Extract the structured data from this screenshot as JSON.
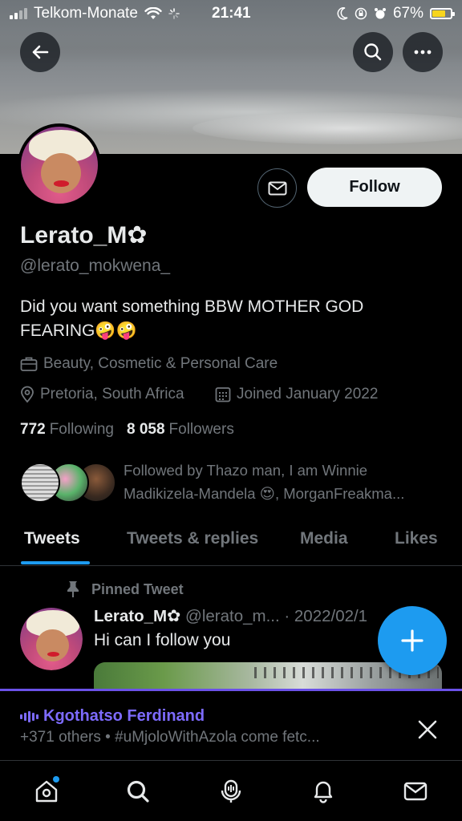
{
  "status_bar": {
    "carrier": "Telkom-Monate",
    "time": "21:41",
    "battery": "67%",
    "battery_level": 0.67
  },
  "profile": {
    "display_name": "Lerato_M✿",
    "handle": "@lerato_mokwena_",
    "bio": "Did you want something BBW MOTHER GOD FEARING🤪🤪",
    "category": "Beauty, Cosmetic & Personal Care",
    "location": "Pretoria, South Africa",
    "joined": "Joined January 2022",
    "following_count": "772",
    "following_label": "Following",
    "followers_count": "8 058",
    "followers_label": "Followers",
    "followed_by": "Followed by Thazo man, I am Winnie Madikizela-Mandela 😍, MorganFreakma..."
  },
  "actions": {
    "follow_label": "Follow"
  },
  "tabs": [
    {
      "label": "Tweets"
    },
    {
      "label": "Tweets & replies"
    },
    {
      "label": "Media"
    },
    {
      "label": "Likes"
    }
  ],
  "pinned_tweet": {
    "pinned_label": "Pinned Tweet",
    "author_name": "Lerato_M✿",
    "author_meta": "@lerato_m... · 2022/02/1",
    "text": "Hi can I follow you"
  },
  "space": {
    "host": "Kgothatso Ferdinand",
    "description": "+371 others • #uMjoloWithAzola come fetc..."
  },
  "colors": {
    "accent": "#1d9bf0",
    "spaces_purple": "#7d6bff",
    "muted_text": "#71767b"
  },
  "icons": {
    "back": "arrow-left-icon",
    "search": "search-icon",
    "more": "more-dots-icon",
    "message": "envelope-icon",
    "pin": "pin-icon",
    "compose": "plus-icon",
    "close": "close-icon"
  }
}
